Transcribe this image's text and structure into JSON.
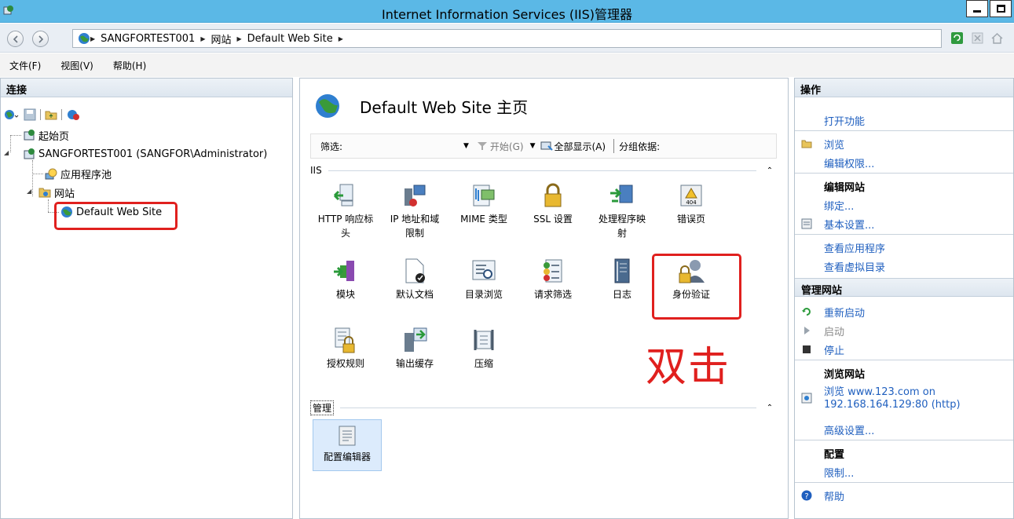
{
  "window": {
    "title": "Internet Information Services (IIS)管理器"
  },
  "address": {
    "crumbs": [
      "SANGFORTEST001",
      "网站",
      "Default Web Site"
    ]
  },
  "menu": {
    "file": "文件(F)",
    "view": "视图(V)",
    "help": "帮助(H)"
  },
  "left": {
    "header": "连接",
    "tree": {
      "start_page": "起始页",
      "server": "SANGFORTEST001 (SANGFOR\\Administrator)",
      "app_pools": "应用程序池",
      "sites": "网站",
      "default_site": "Default Web Site"
    }
  },
  "center": {
    "title": "Default Web Site 主页",
    "filter": {
      "label": "筛选:",
      "start": "开始(G)",
      "show_all": "全部显示(A)",
      "group_by": "分组依据:"
    },
    "groups": {
      "iis": "IIS",
      "manage": "管理"
    },
    "features": {
      "http_headers_1": "HTTP 响应标",
      "http_headers_2": "头",
      "ip_restrict_1": "IP 地址和域",
      "ip_restrict_2": "限制",
      "mime": "MIME 类型",
      "ssl": "SSL 设置",
      "handler_1": "处理程序映",
      "handler_2": "射",
      "errors": "错误页",
      "modules": "模块",
      "default_doc": "默认文档",
      "dir_browse": "目录浏览",
      "req_filter": "请求筛选",
      "logging": "日志",
      "auth": "身份验证",
      "authz": "授权规则",
      "output_cache": "输出缓存",
      "compression": "压缩",
      "config_editor": "配置编辑器"
    },
    "annotation": "双击"
  },
  "right": {
    "header": "操作",
    "open_feature": "打开功能",
    "explore": "浏览",
    "edit_perms": "编辑权限...",
    "edit_site": "编辑网站",
    "bindings": "绑定...",
    "basic_settings": "基本设置...",
    "view_apps": "查看应用程序",
    "view_vdirs": "查看虚拟目录",
    "manage_site": "管理网站",
    "restart": "重新启动",
    "start": "启动",
    "stop": "停止",
    "browse_site": "浏览网站",
    "browse_link_1": "浏览 www.123.com on",
    "browse_link_2": "192.168.164.129:80 (http)",
    "advanced": "高级设置...",
    "config": "配置",
    "limits": "限制...",
    "help": "帮助"
  },
  "colors": {
    "titlebar": "#5bb8e6",
    "link": "#1f5fbf",
    "annotation_red": "#e0201e"
  }
}
